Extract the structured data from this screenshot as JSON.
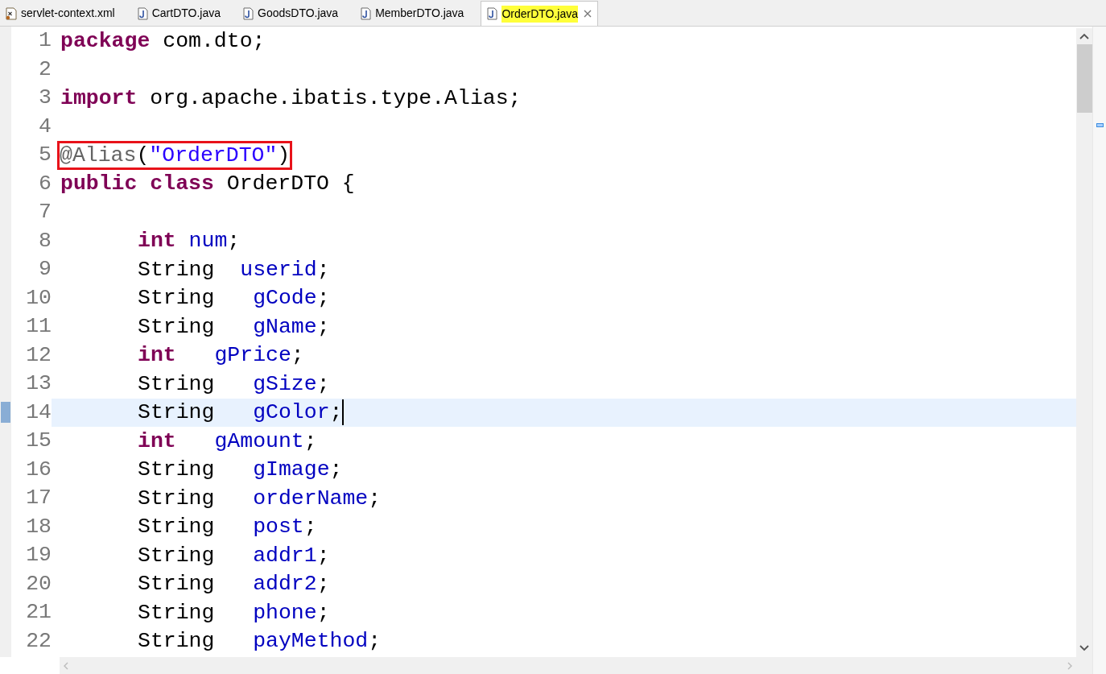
{
  "tabs": [
    {
      "label": "servlet-context.xml",
      "kind": "xml",
      "selected": false,
      "marked": false
    },
    {
      "label": "CartDTO.java",
      "kind": "java",
      "selected": false,
      "marked": false
    },
    {
      "label": "GoodsDTO.java",
      "kind": "java",
      "selected": false,
      "marked": false
    },
    {
      "label": "MemberDTO.java",
      "kind": "java",
      "selected": false,
      "marked": false
    },
    {
      "label": "OrderDTO.java",
      "kind": "java",
      "selected": true,
      "marked": true
    }
  ],
  "editor": {
    "lines": [
      {
        "number": "1",
        "current": false,
        "boxed": false,
        "tokens": [
          {
            "kind": "keyword",
            "text": "package"
          },
          {
            "kind": "plain",
            "text": " com.dto;"
          }
        ]
      },
      {
        "number": "2",
        "current": false
      },
      {
        "number": "3",
        "current": false,
        "boxed": false,
        "tokens": [
          {
            "kind": "keyword",
            "text": "import"
          },
          {
            "kind": "plain",
            "text": " org.apache.ibatis.type.Alias;"
          }
        ]
      },
      {
        "number": "4",
        "current": false
      },
      {
        "number": "5",
        "current": false,
        "boxed": true,
        "tokens": [
          {
            "kind": "annotation",
            "text": "@Alias"
          },
          {
            "kind": "plain",
            "text": "("
          },
          {
            "kind": "string",
            "text": "\"OrderDTO\""
          },
          {
            "kind": "plain",
            "text": ")"
          }
        ]
      },
      {
        "number": "6",
        "current": false,
        "boxed": false,
        "tokens": [
          {
            "kind": "keyword",
            "text": "public"
          },
          {
            "kind": "keyword",
            "text": " class"
          },
          {
            "kind": "plain",
            "text": " OrderDTO {"
          }
        ],
        "children": [
          {
            "number": "7",
            "current": false
          },
          {
            "number": "8",
            "current": false,
            "boxed": false,
            "tokens": [
              {
                "kind": "keyword",
                "text": "int"
              },
              {
                "kind": "field",
                "text": " num"
              },
              {
                "kind": "plain",
                "text": ";"
              }
            ]
          },
          {
            "number": "9",
            "current": false,
            "boxed": false,
            "tokens": [
              {
                "kind": "plain",
                "text": "String"
              },
              {
                "kind": "field",
                "text": "  userid"
              },
              {
                "kind": "plain",
                "text": ";"
              }
            ]
          },
          {
            "number": "10",
            "current": false,
            "boxed": false,
            "tokens": [
              {
                "kind": "plain",
                "text": "String"
              },
              {
                "kind": "field",
                "text": "   gCode"
              },
              {
                "kind": "plain",
                "text": ";"
              }
            ]
          },
          {
            "number": "11",
            "current": false,
            "boxed": false,
            "tokens": [
              {
                "kind": "plain",
                "text": "String"
              },
              {
                "kind": "field",
                "text": "   gName"
              },
              {
                "kind": "plain",
                "text": ";"
              }
            ]
          },
          {
            "number": "12",
            "current": false,
            "boxed": false,
            "tokens": [
              {
                "kind": "keyword",
                "text": "int"
              },
              {
                "kind": "field",
                "text": "   gPrice"
              },
              {
                "kind": "plain",
                "text": ";"
              }
            ]
          },
          {
            "number": "13",
            "current": false,
            "boxed": false,
            "tokens": [
              {
                "kind": "plain",
                "text": "String"
              },
              {
                "kind": "field",
                "text": "   gSize"
              },
              {
                "kind": "plain",
                "text": ";"
              }
            ]
          },
          {
            "number": "14",
            "current": true,
            "boxed": false,
            "tokens": [
              {
                "kind": "plain",
                "text": "String"
              },
              {
                "kind": "field",
                "text": "   gColor"
              },
              {
                "kind": "plain",
                "text": ";"
              }
            ]
          },
          {
            "number": "15",
            "current": false,
            "boxed": false,
            "tokens": [
              {
                "kind": "keyword",
                "text": "int"
              },
              {
                "kind": "field",
                "text": "   gAmount"
              },
              {
                "kind": "plain",
                "text": ";"
              }
            ]
          },
          {
            "number": "16",
            "current": false,
            "boxed": false,
            "tokens": [
              {
                "kind": "plain",
                "text": "String"
              },
              {
                "kind": "field",
                "text": "   gImage"
              },
              {
                "kind": "plain",
                "text": ";"
              }
            ]
          },
          {
            "number": "17",
            "current": false,
            "boxed": false,
            "tokens": [
              {
                "kind": "plain",
                "text": "String"
              },
              {
                "kind": "field",
                "text": "   orderName"
              },
              {
                "kind": "plain",
                "text": ";"
              }
            ]
          },
          {
            "number": "18",
            "current": false,
            "boxed": false,
            "tokens": [
              {
                "kind": "plain",
                "text": "String"
              },
              {
                "kind": "field",
                "text": "   post"
              },
              {
                "kind": "plain",
                "text": ";"
              }
            ]
          },
          {
            "number": "19",
            "current": false,
            "boxed": false,
            "tokens": [
              {
                "kind": "plain",
                "text": "String"
              },
              {
                "kind": "field",
                "text": "   addr1"
              },
              {
                "kind": "plain",
                "text": ";"
              }
            ]
          },
          {
            "number": "20",
            "current": false,
            "boxed": false,
            "tokens": [
              {
                "kind": "plain",
                "text": "String"
              },
              {
                "kind": "field",
                "text": "   addr2"
              },
              {
                "kind": "plain",
                "text": ";"
              }
            ]
          },
          {
            "number": "21",
            "current": false,
            "boxed": false,
            "tokens": [
              {
                "kind": "plain",
                "text": "String"
              },
              {
                "kind": "field",
                "text": "   phone"
              },
              {
                "kind": "plain",
                "text": ";"
              }
            ]
          },
          {
            "number": "22",
            "current": false,
            "boxed": false,
            "tokens": [
              {
                "kind": "plain",
                "text": "String"
              },
              {
                "kind": "field",
                "text": "   payMethod"
              },
              {
                "kind": "plain",
                "text": ";"
              }
            ]
          }
        ]
      }
    ]
  }
}
